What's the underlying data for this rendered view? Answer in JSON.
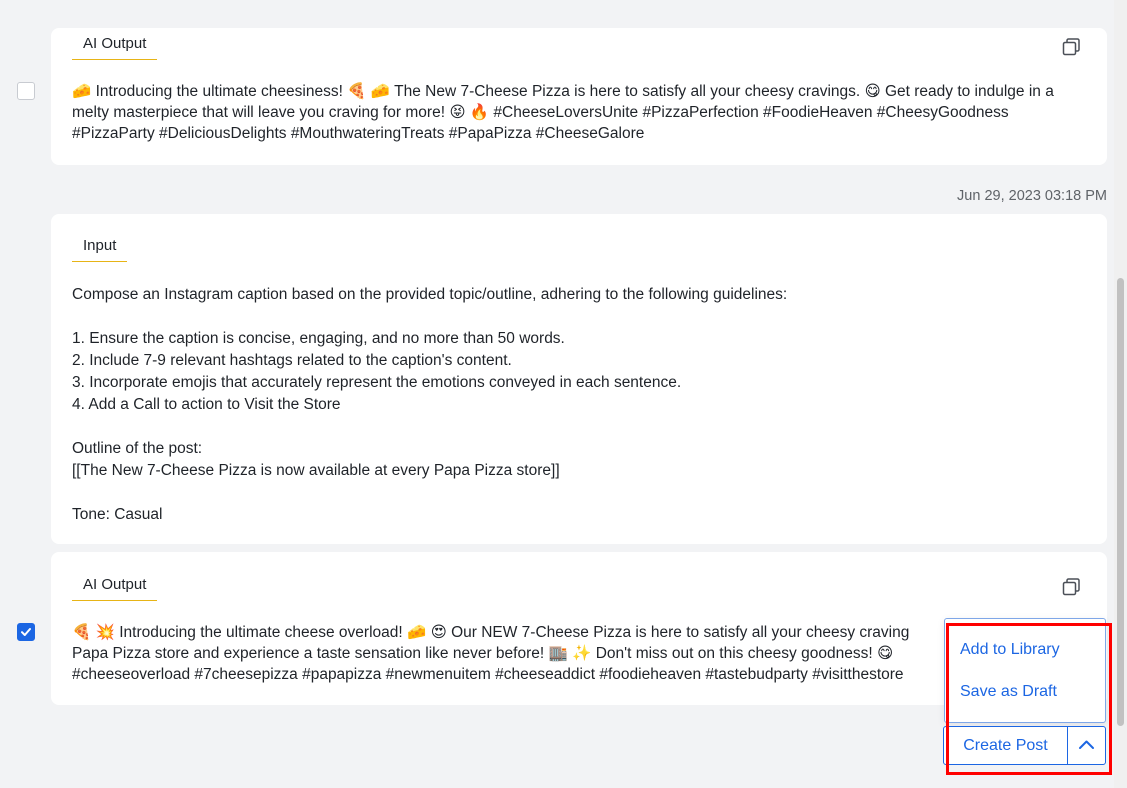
{
  "cards": [
    {
      "tag": "AI Output",
      "text": "🧀 Introducing the ultimate cheesiness! 🍕 🧀 The New 7-Cheese Pizza is here to satisfy all your cheesy cravings. 😋 Get ready to indulge in a melty masterpiece that will leave you craving for more! 😝 🔥 #CheeseLoversUnite #PizzaPerfection #FoodieHeaven #CheesyGoodness #PizzaParty #DeliciousDelights #MouthwateringTreats #PapaPizza #CheeseGalore",
      "selected": false
    },
    {
      "tag": "Input",
      "text": "Compose an Instagram caption based on the provided topic/outline, adhering to the following guidelines:\n\n1. Ensure the caption is concise, engaging, and no more than 50 words.\n2. Include 7-9 relevant hashtags related to the caption's content.\n3. Incorporate emojis that accurately represent the emotions conveyed in each sentence.\n4. Add a Call to action to Visit the Store\n\nOutline of the post:\n[[The New 7-Cheese Pizza is now available at every Papa Pizza store]]\n\nTone: Casual"
    },
    {
      "tag": "AI Output",
      "text": "🍕 💥 Introducing the ultimate cheese overload! 🧀 😍 Our NEW 7-Cheese Pizza is here to satisfy all your cheesy craving\nPapa Pizza store and experience a taste sensation like never before! 🏬 ✨ Don't miss out on this cheesy goodness! 😋\n#cheeseoverload #7cheesepizza #papapizza #newmenuitem #cheeseaddict #foodieheaven #tastebudparty #visitthestore",
      "selected": true
    }
  ],
  "timestamp": "Jun 29, 2023 03:18 PM",
  "menu": {
    "add_to_library": "Add to Library",
    "save_as_draft": "Save as Draft"
  },
  "actions": {
    "create_post": "Create Post"
  },
  "colors": {
    "accent": "#1c66e3",
    "tag_underline": "#e7b416",
    "highlight": "#ff0000"
  }
}
